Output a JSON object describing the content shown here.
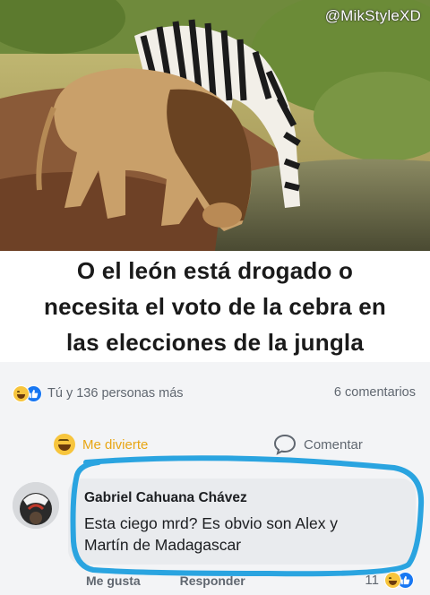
{
  "photo": {
    "watermark": "@MikStyleXD",
    "subjects": [
      "lion",
      "zebra"
    ]
  },
  "caption": {
    "lines": [
      "O el león está drogado o",
      "necesita el voto de la cebra en",
      "las elecciones de la jungla"
    ]
  },
  "post": {
    "reactions_text": "Tú y 136 personas más",
    "comments_count": "6 comentarios",
    "reaction_button": "Me divierte",
    "comment_button": "Comentar"
  },
  "comment": {
    "author": "Gabriel Cahuana Chávez",
    "text_line1": "Esta ciego mrd? Es obvio son Alex y",
    "text_line2": "Martín de Madagascar",
    "like_label": "Me gusta",
    "reply_label": "Responder",
    "reaction_count": "11"
  },
  "colors": {
    "highlight": "#2aa4e0",
    "haha_text": "#e8a614",
    "like_blue": "#1877f2",
    "bubble": "#e9ebee"
  }
}
